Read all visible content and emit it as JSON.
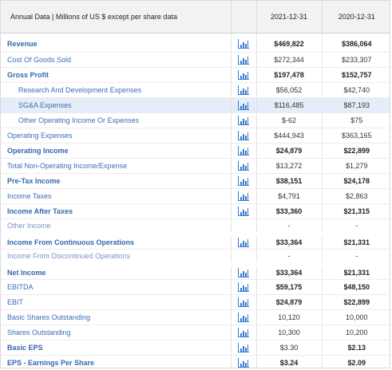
{
  "header": {
    "title": "Annual Data | Millions of US $ except per share data",
    "years": [
      "2021-12-31",
      "2020-12-31"
    ]
  },
  "colors": {
    "link": "#3e6db5",
    "highlight": "#e4edf8",
    "icon": "#3a7bd5"
  },
  "rows": [
    {
      "label": "Revenue",
      "v1": "$469,822",
      "v2": "$386,064"
    },
    {
      "label": "Cost Of Goods Sold",
      "v1": "$272,344",
      "v2": "$233,307"
    },
    {
      "label": "Gross Profit",
      "v1": "$197,478",
      "v2": "$152,757"
    },
    {
      "label": "Research And Development Expenses",
      "v1": "$56,052",
      "v2": "$42,740"
    },
    {
      "label": "SG&A Expenses",
      "v1": "$116,485",
      "v2": "$87,193"
    },
    {
      "label": "Other Operating Income Or Expenses",
      "v1": "$-62",
      "v2": "$75"
    },
    {
      "label": "Operating Expenses",
      "v1": "$444,943",
      "v2": "$363,165"
    },
    {
      "label": "Operating Income",
      "v1": "$24,879",
      "v2": "$22,899"
    },
    {
      "label": "Total Non-Operating Income/Expense",
      "v1": "$13,272",
      "v2": "$1,279"
    },
    {
      "label": "Pre-Tax Income",
      "v1": "$38,151",
      "v2": "$24,178"
    },
    {
      "label": "Income Taxes",
      "v1": "$4,791",
      "v2": "$2,863"
    },
    {
      "label": "Income After Taxes",
      "v1": "$33,360",
      "v2": "$21,315"
    },
    {
      "label": "Other Income",
      "v1": "-",
      "v2": "-"
    },
    {
      "label": "Income From Continuous Operations",
      "v1": "$33,364",
      "v2": "$21,331"
    },
    {
      "label": "Income From Discontinued Operations",
      "v1": "-",
      "v2": "-"
    },
    {
      "label": "Net Income",
      "v1": "$33,364",
      "v2": "$21,331"
    },
    {
      "label": "EBITDA",
      "v1": "$59,175",
      "v2": "$48,150"
    },
    {
      "label": "EBIT",
      "v1": "$24,879",
      "v2": "$22,899"
    },
    {
      "label": "Basic Shares Outstanding",
      "v1": "10,120",
      "v2": "10,000"
    },
    {
      "label": "Shares Outstanding",
      "v1": "10,300",
      "v2": "10,200"
    },
    {
      "label": "Basic EPS",
      "v1": "$3.30",
      "v2": "$2.13"
    },
    {
      "label": "EPS - Earnings Per Share",
      "v1": "$3.24",
      "v2": "$2.09"
    }
  ]
}
